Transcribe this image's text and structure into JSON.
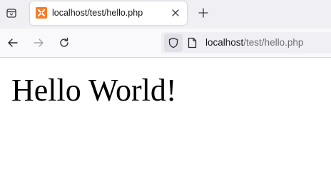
{
  "browser": {
    "tab": {
      "title": "localhost/test/hello.php"
    },
    "address": {
      "host": "localhost",
      "path": "/test/hello.php"
    }
  },
  "page": {
    "heading": "Hello World!"
  },
  "icons": {
    "tab_list": "tab-list-icon",
    "favicon": "xampp-favicon-icon",
    "close": "close-icon",
    "new_tab": "plus-icon",
    "back": "arrow-left-icon",
    "forward": "arrow-right-icon",
    "reload": "reload-icon",
    "shield": "shield-icon",
    "page": "page-icon"
  },
  "colors": {
    "favicon": "#fb7a24",
    "tab_bar": "#f0f0f4",
    "toolbar": "#f9f9fb",
    "text": "#15141a",
    "url_path": "#6d6d74"
  }
}
